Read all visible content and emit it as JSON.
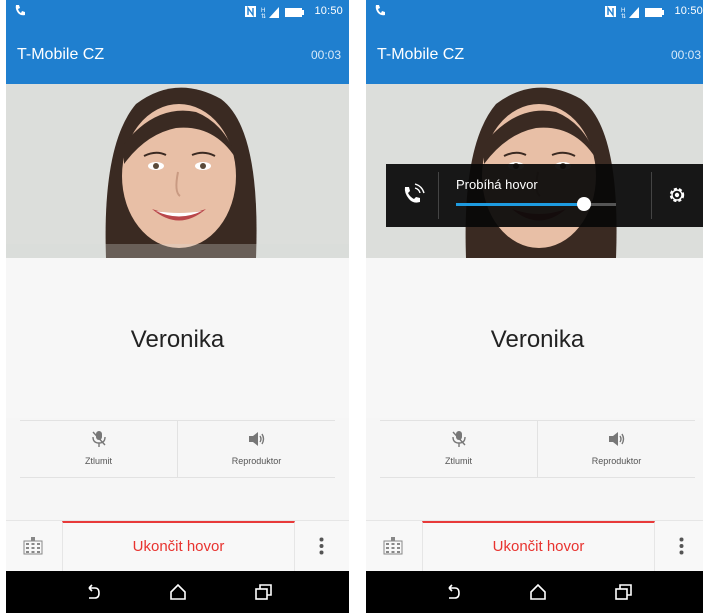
{
  "colors": {
    "accent_blue": "#1f7fcf",
    "end_call_red": "#e8332f",
    "volume_blue": "#1e9be0"
  },
  "screens": [
    {
      "status_bar": {
        "time": "10:50",
        "icons": [
          "phone-icon",
          "nfc-icon",
          "signal-icon",
          "battery-icon"
        ]
      },
      "carrier": "T-Mobile CZ",
      "call_timer": "00:03",
      "contact_name": "Veronika",
      "buttons": [
        {
          "label": "Ztlumit",
          "icon": "microphone-mute-icon"
        },
        {
          "label": "Reproduktor",
          "icon": "speaker-icon"
        }
      ],
      "end_call_label": "Ukončit hovor",
      "nav_icons": [
        "back-icon",
        "home-icon",
        "recent-apps-icon"
      ]
    },
    {
      "status_bar": {
        "time": "10:50",
        "icons": [
          "phone-icon",
          "nfc-icon",
          "signal-icon",
          "battery-icon"
        ]
      },
      "carrier": "T-Mobile CZ",
      "call_timer": "00:03",
      "contact_name": "Veronika",
      "buttons": [
        {
          "label": "Ztlumit",
          "icon": "microphone-mute-icon"
        },
        {
          "label": "Reproduktor",
          "icon": "speaker-icon"
        }
      ],
      "end_call_label": "Ukončit hovor",
      "nav_icons": [
        "back-icon",
        "home-icon",
        "recent-apps-icon"
      ],
      "volume_overlay": {
        "label": "Probíhá hovor",
        "level": 0.8,
        "icons": [
          "call-volume-icon",
          "settings-gear-icon"
        ]
      }
    }
  ]
}
